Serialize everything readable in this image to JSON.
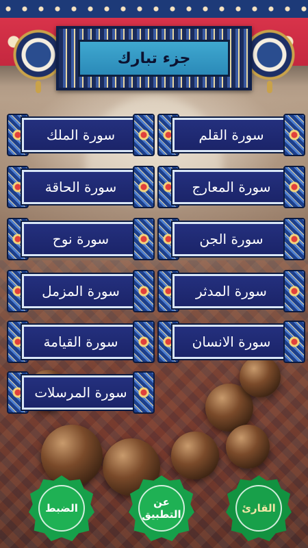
{
  "header": {
    "title": "جزء تبارك"
  },
  "surahs": [
    {
      "id": "al-mulk",
      "label": "سورة الملك"
    },
    {
      "id": "al-qalam",
      "label": "سورة القلم"
    },
    {
      "id": "al-haqqa",
      "label": "سورة الحاقة"
    },
    {
      "id": "al-maarij",
      "label": "سورة المعارج"
    },
    {
      "id": "nuh",
      "label": "سورة نوح"
    },
    {
      "id": "al-jinn",
      "label": "سورة الجن"
    },
    {
      "id": "al-muzzammil",
      "label": "سورة المزمل"
    },
    {
      "id": "al-muddaththir",
      "label": "سورة المدثر"
    },
    {
      "id": "al-qiyama",
      "label": "سورة القيامة"
    },
    {
      "id": "al-insan",
      "label": "سورة الانسان"
    },
    {
      "id": "al-mursalat",
      "label": "سورة المرسلات"
    }
  ],
  "bottom_nav": {
    "settings_label": "الضبط",
    "about_label": "عن\nالتطبيق",
    "reader_label": "القارئ"
  },
  "colors": {
    "button_fill": "#1b2469",
    "round_button": "#16a04a",
    "title_box": "#3fa8d0"
  }
}
